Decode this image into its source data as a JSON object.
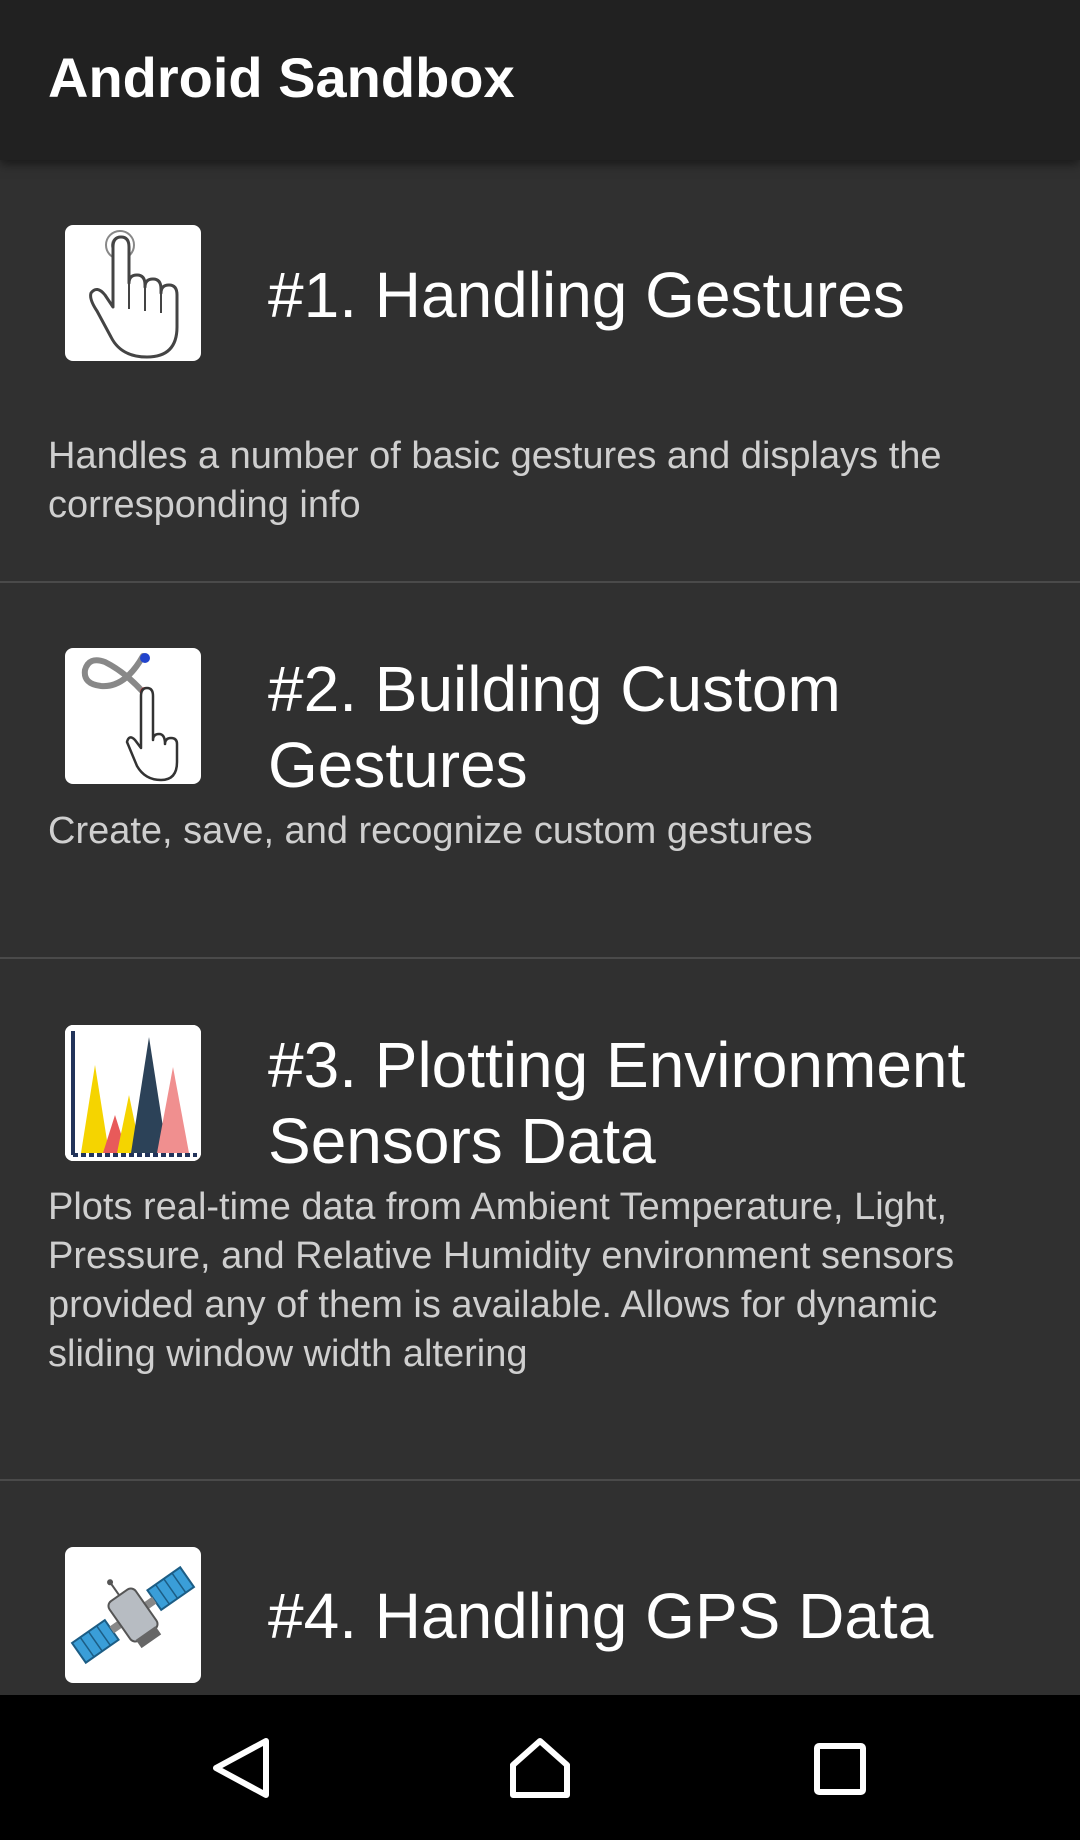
{
  "app": {
    "title": "Android Sandbox"
  },
  "items": [
    {
      "title": "#1. Handling Gestures",
      "description": "Handles a number of basic gestures and displays the corresponding info",
      "icon": "tap-gesture-icon"
    },
    {
      "title": "#2. Building Custom Gestures",
      "description": "Create, save, and recognize custom gestures",
      "icon": "custom-gesture-icon"
    },
    {
      "title": "#3. Plotting Environment Sensors Data",
      "description": "Plots real-time data from Ambient Temperature, Light, Pressure, and Relative Humidity environment sensors provided any of them is available. Allows for dynamic sliding window width altering",
      "icon": "chart-icon"
    },
    {
      "title": "#4. Handling GPS Data",
      "description": "",
      "icon": "satellite-icon"
    }
  ],
  "navigation": {
    "back": "back-icon",
    "home": "home-icon",
    "recents": "recents-icon"
  },
  "colors": {
    "app_bar": "#212121",
    "background": "#303030",
    "divider": "#4a4a4a",
    "title_text": "#ffffff",
    "description_text": "#cfcfcf",
    "nav_bar": "#000000"
  }
}
